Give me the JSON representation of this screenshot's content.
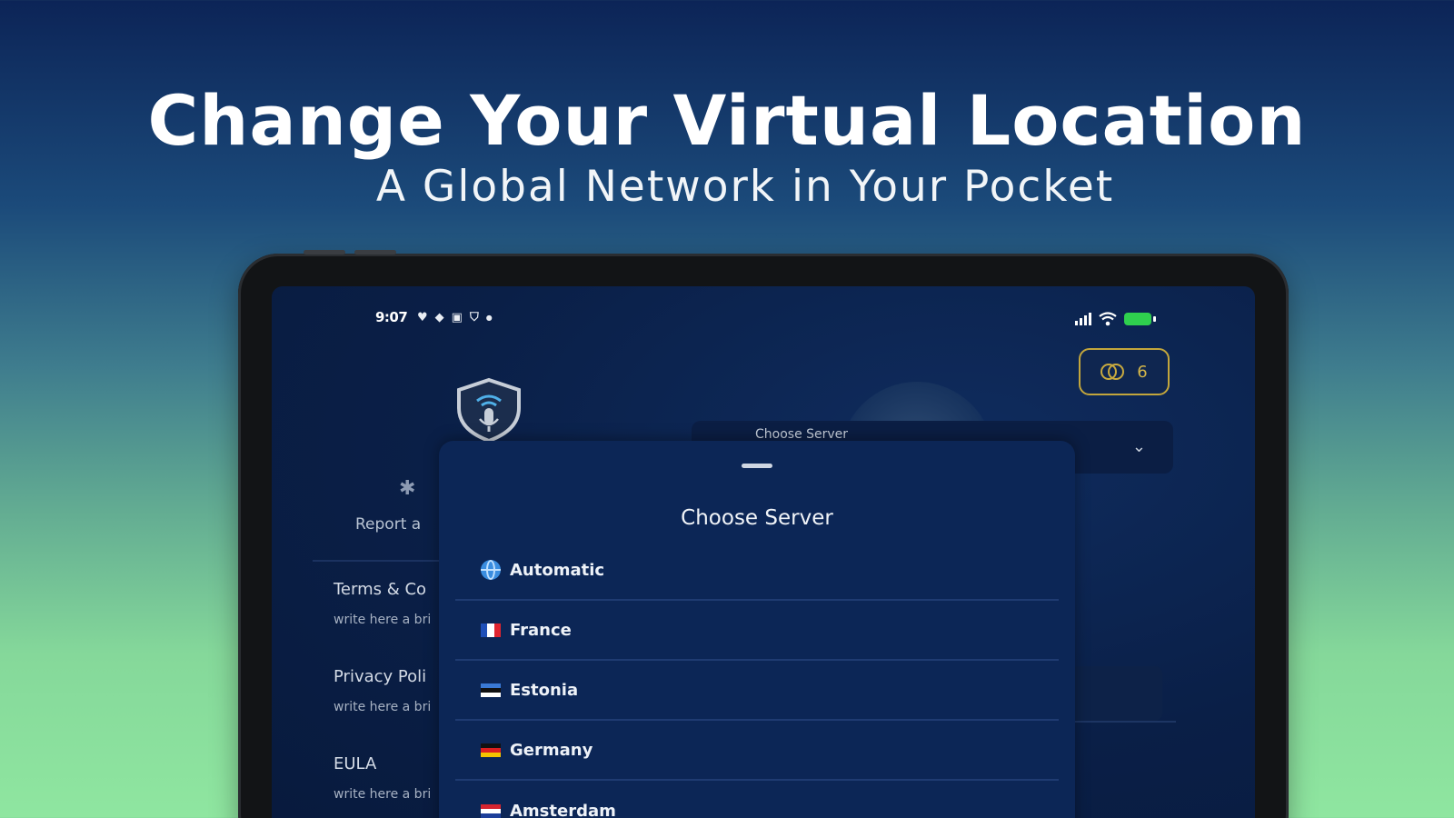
{
  "headline": "Change Your Virtual Location",
  "subheadline": "A Global Network in Your Pocket",
  "status_bar": {
    "time": "9:07"
  },
  "coins": {
    "count": "6"
  },
  "background_dropdown": {
    "label": "Choose Server"
  },
  "menu": {
    "report_label": "Report a",
    "items": [
      {
        "title": "Terms & Co",
        "subtitle": "write here a bri"
      },
      {
        "title": "Privacy Poli",
        "subtitle": "write here a bri"
      },
      {
        "title": "EULA",
        "subtitle": "write here a bri"
      }
    ]
  },
  "sheet": {
    "title": "Choose Server",
    "servers": [
      {
        "name": "Automatic",
        "icon": "globe-icon"
      },
      {
        "name": "France",
        "icon": "flag-france"
      },
      {
        "name": "Estonia",
        "icon": "flag-estonia"
      },
      {
        "name": "Germany",
        "icon": "flag-germany"
      },
      {
        "name": "Amsterdam",
        "icon": "flag-netherlands"
      }
    ]
  },
  "colors": {
    "accent_gold": "#c3a63c",
    "screen_bg": "#0a1f47",
    "sheet_bg": "#0c2656",
    "battery": "#2fd04e"
  }
}
